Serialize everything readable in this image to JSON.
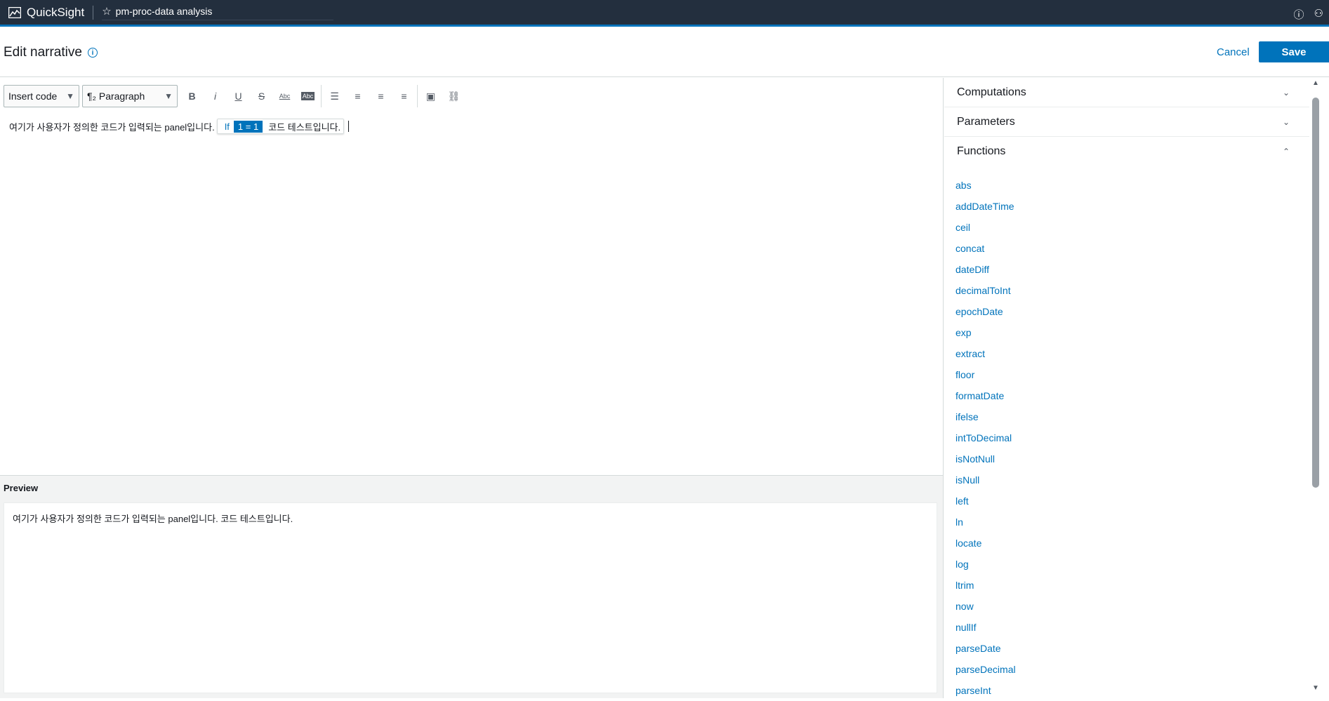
{
  "topbar": {
    "brand": "QuickSight",
    "analysis_name": "pm-proc-data analysis",
    "star_icon": "star-icon",
    "help_icon": "help-icon",
    "user_icon": "user-icon"
  },
  "header": {
    "title": "Edit narrative",
    "cancel_label": "Cancel",
    "save_label": "Save"
  },
  "toolbar": {
    "insert_code_label": "Insert code",
    "paragraph_label": "Paragraph",
    "paragraph_icon": "¶₂",
    "bold": "B",
    "italic": "i",
    "underline": "U",
    "strike": "S",
    "font_size": "Abc",
    "font_color": "Abc"
  },
  "editor": {
    "text_before": "여기가 사용자가 정의한 코드가 입력되는 panel입니다.",
    "code_keyword": "If",
    "code_condition": "1 = 1",
    "code_body": "코드 테스트입니다."
  },
  "preview": {
    "label": "Preview",
    "text": "여기가 사용자가 정의한 코드가 입력되는 panel입니다. 코드 테스트입니다."
  },
  "sidepanel": {
    "sections": [
      {
        "label": "Computations",
        "expanded": false
      },
      {
        "label": "Parameters",
        "expanded": false
      },
      {
        "label": "Functions",
        "expanded": true
      }
    ],
    "functions": [
      "abs",
      "addDateTime",
      "ceil",
      "concat",
      "dateDiff",
      "decimalToInt",
      "epochDate",
      "exp",
      "extract",
      "floor",
      "formatDate",
      "ifelse",
      "intToDecimal",
      "isNotNull",
      "isNull",
      "left",
      "ln",
      "locate",
      "log",
      "ltrim",
      "now",
      "nullIf",
      "parseDate",
      "parseDecimal",
      "parseInt"
    ]
  },
  "colors": {
    "accent": "#0073bb",
    "topbar_bg": "#232f3e"
  }
}
